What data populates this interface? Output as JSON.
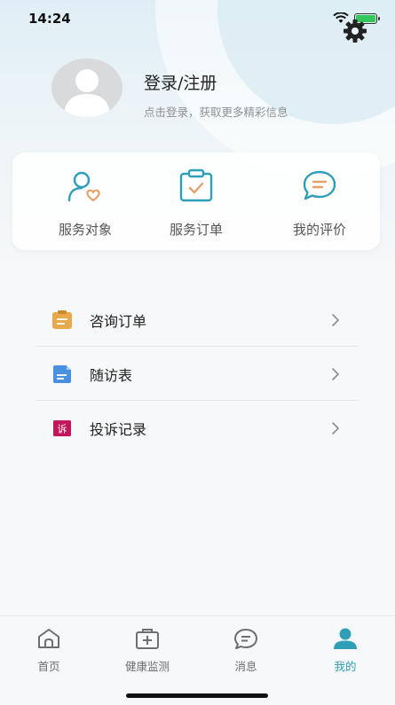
{
  "status_bar": {
    "time": "14:24"
  },
  "profile": {
    "login_title": "登录/注册",
    "login_subtitle": "点击登录，获取更多精彩信息"
  },
  "services": [
    {
      "label": "服务对象",
      "icon": "person-heart-icon"
    },
    {
      "label": "服务订单",
      "icon": "clipboard-check-icon"
    },
    {
      "label": "我的评价",
      "icon": "chat-bubble-icon"
    }
  ],
  "menu": [
    {
      "label": "咨询订单",
      "icon": "consult-order-icon",
      "color": "#e8a94a"
    },
    {
      "label": "随访表",
      "icon": "document-icon",
      "color": "#4a90e2"
    },
    {
      "label": "投诉记录",
      "icon": "complaint-icon",
      "icon_text": "诉",
      "color": "#c2185b"
    }
  ],
  "tabs": [
    {
      "label": "首页",
      "icon": "home-icon",
      "active": false
    },
    {
      "label": "健康监测",
      "icon": "medical-kit-icon",
      "active": false
    },
    {
      "label": "消息",
      "icon": "message-icon",
      "active": false
    },
    {
      "label": "我的",
      "icon": "user-icon",
      "active": true
    }
  ],
  "colors": {
    "accent": "#2e9fb6",
    "active_tab": "#2e9fb6"
  }
}
